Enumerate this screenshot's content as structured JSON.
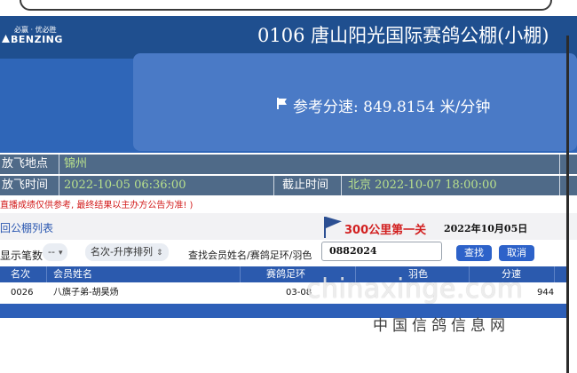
{
  "header": {
    "logo_slogan": "必赢 · 优必胜",
    "logo_brand": "BENZING",
    "title": "0106 唐山阳光国际赛鸽公棚(小棚)"
  },
  "speed": {
    "text": "参考分速: 849.8154 米/分钟"
  },
  "release": {
    "location_label": "放飞地点",
    "location_value": "锦州",
    "time_label": "放飞时间",
    "time_value": "2022-10-05 06:36:00",
    "deadline_label": "截止时间",
    "deadline_value": "北京 2022-10-07 18:00:00"
  },
  "notice": "直播成绩仅供参考, 最终结果以主办方公告为准! )",
  "subheader": {
    "member_list_link": "回公棚列表",
    "race_title": "300公里第一关",
    "race_date": "2022年10月05日"
  },
  "filters": {
    "display_count_label": "显示笔数",
    "display_count_value": "--",
    "sort_value": "名次-升序排列",
    "search_label": "查找会员姓名/赛鸽足环/羽色",
    "search_value": "0882024",
    "search_button": "查找",
    "cancel_button": "取消"
  },
  "table": {
    "columns": [
      "名次",
      "会员姓名",
      "赛鸽足环",
      "羽色",
      "分速"
    ],
    "rows": [
      {
        "rank": "0026",
        "name": "八旗子弟-胡昊炀",
        "ring": "03-08",
        "color": "",
        "speed": "944"
      }
    ]
  },
  "watermark": {
    "domain": "chinaxinge.com",
    "site_name": "中国信鸽信息网"
  }
}
